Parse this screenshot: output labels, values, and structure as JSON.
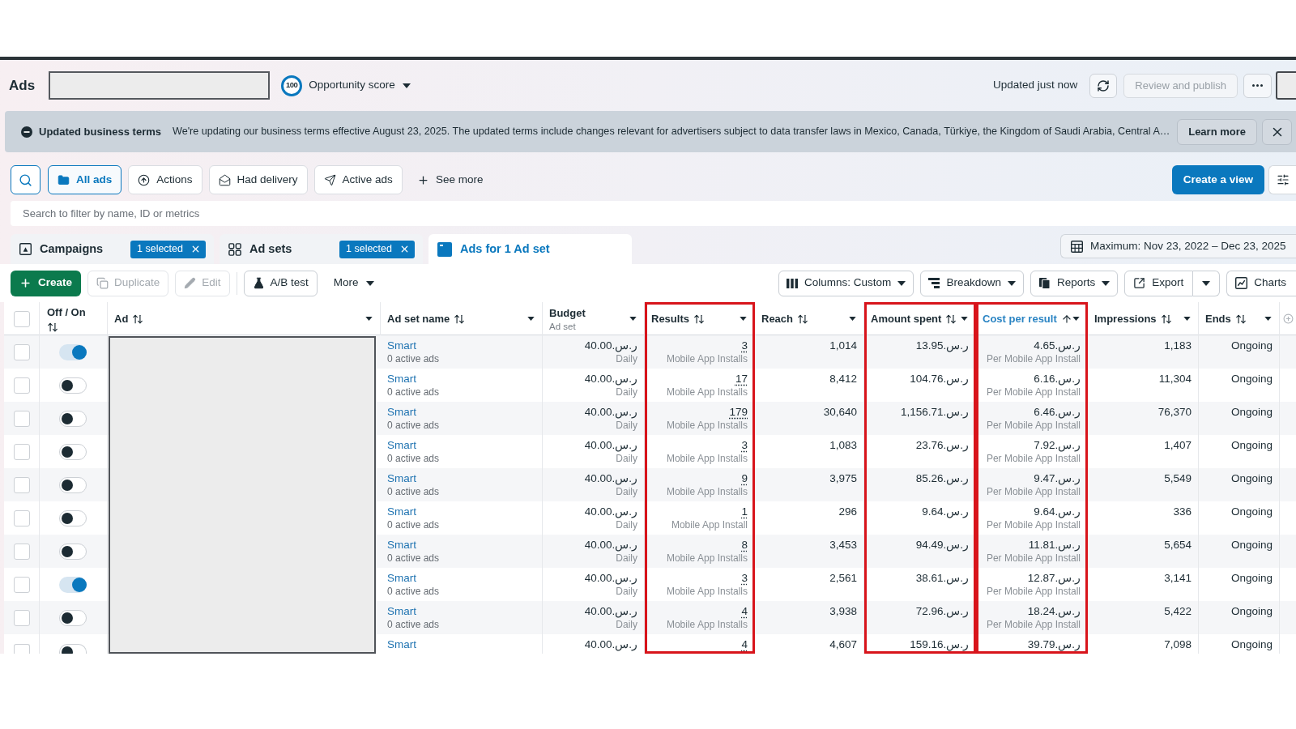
{
  "header": {
    "title": "Ads",
    "opportunity_score": {
      "value": "100",
      "label": "Opportunity score"
    },
    "update_status": "Updated just now",
    "review_button": {
      "label": "Review and publish",
      "disabled": true
    }
  },
  "notice": {
    "title": "Updated business terms",
    "message": "We're updating our business terms effective August 23, 2025. The updated terms include changes relevant for advertisers subject to data transfer laws in Mexico, Canada, Türkiye, the Kingdom of Saudi Arabia, Central A…",
    "action": "Learn more"
  },
  "views": {
    "items": [
      {
        "label": "All ads",
        "selected": true
      },
      {
        "label": "Actions",
        "selected": false
      },
      {
        "label": "Had delivery",
        "selected": false
      },
      {
        "label": "Active ads",
        "selected": false
      }
    ],
    "see_more": "See more",
    "create_view": "Create a view"
  },
  "search": {
    "placeholder": "Search to filter by name, ID or metrics"
  },
  "levels": {
    "tabs": [
      {
        "label": "Campaigns",
        "badge": "1 selected",
        "selected": false
      },
      {
        "label": "Ad sets",
        "badge": "1 selected",
        "selected": false
      },
      {
        "label": "Ads for 1 Ad set",
        "selected": true
      }
    ],
    "date_range": "Maximum: Nov 23, 2022 – Dec 23, 2025"
  },
  "toolbar": {
    "left": [
      {
        "label": "Create",
        "kind": "primary",
        "disabled": false
      },
      {
        "label": "Duplicate",
        "kind": "outline",
        "disabled": true
      },
      {
        "label": "Edit",
        "kind": "outline",
        "disabled": true
      },
      {
        "label": "A/B test",
        "kind": "outline",
        "disabled": false
      },
      {
        "label": "More",
        "kind": "menu",
        "disabled": false
      }
    ],
    "right": [
      {
        "label": "Columns: Custom",
        "kind": "menu"
      },
      {
        "label": "Breakdown",
        "kind": "menu"
      },
      {
        "label": "Reports",
        "kind": "menu"
      },
      {
        "label": "Export",
        "kind": "split"
      },
      {
        "label": "Charts",
        "kind": "plain"
      }
    ]
  },
  "table": {
    "select_all_checked": false,
    "columns": [
      {
        "label": "Off / On",
        "sortable": true,
        "sorted": false,
        "highlighted": false
      },
      {
        "label": "Ad",
        "sortable": true,
        "sorted": false,
        "highlighted": false
      },
      {
        "label": "Ad set name",
        "sortable": true,
        "sorted": false,
        "highlighted": false
      },
      {
        "label": "Budget",
        "sublabel": "Ad set",
        "sortable": false,
        "sorted": false,
        "highlighted": false
      },
      {
        "label": "Results",
        "sortable": true,
        "sorted": false,
        "highlighted": true
      },
      {
        "label": "Reach",
        "sortable": true,
        "sorted": false,
        "highlighted": false
      },
      {
        "label": "Amount spent",
        "sortable": true,
        "sorted": false,
        "highlighted": true
      },
      {
        "label": "Cost per result",
        "sortable": true,
        "sorted": true,
        "highlighted": true
      },
      {
        "label": "Impressions",
        "sortable": true,
        "sorted": false,
        "highlighted": false
      },
      {
        "label": "Ends",
        "sortable": true,
        "sorted": false,
        "highlighted": false
      }
    ],
    "rows": [
      {
        "selected": false,
        "on": true,
        "ad_set_name": "Smart",
        "ad_set_status": "0 active ads",
        "budget": "ر.س.40.00",
        "budget_period": "Daily",
        "results": "3",
        "result_type": "Mobile App Installs",
        "reach": "1,014",
        "amount_spent": "ر.س.13.95",
        "cost_per_result": "ر.س.4.65",
        "cost_basis": "Per Mobile App Install",
        "impressions": "1,183",
        "ends": "Ongoing"
      },
      {
        "selected": false,
        "on": false,
        "ad_set_name": "Smart",
        "ad_set_status": "0 active ads",
        "budget": "ر.س.40.00",
        "budget_period": "Daily",
        "results": "17",
        "result_type": "Mobile App Installs",
        "reach": "8,412",
        "amount_spent": "ر.س.104.76",
        "cost_per_result": "ر.س.6.16",
        "cost_basis": "Per Mobile App Install",
        "impressions": "11,304",
        "ends": "Ongoing"
      },
      {
        "selected": false,
        "on": false,
        "ad_set_name": "Smart",
        "ad_set_status": "0 active ads",
        "budget": "ر.س.40.00",
        "budget_period": "Daily",
        "results": "179",
        "result_type": "Mobile App Installs",
        "reach": "30,640",
        "amount_spent": "ر.س.1,156.71",
        "cost_per_result": "ر.س.6.46",
        "cost_basis": "Per Mobile App Install",
        "impressions": "76,370",
        "ends": "Ongoing"
      },
      {
        "selected": false,
        "on": false,
        "ad_set_name": "Smart",
        "ad_set_status": "0 active ads",
        "budget": "ر.س.40.00",
        "budget_period": "Daily",
        "results": "3",
        "result_type": "Mobile App Installs",
        "reach": "1,083",
        "amount_spent": "ر.س.23.76",
        "cost_per_result": "ر.س.7.92",
        "cost_basis": "Per Mobile App Install",
        "impressions": "1,407",
        "ends": "Ongoing"
      },
      {
        "selected": false,
        "on": false,
        "ad_set_name": "Smart",
        "ad_set_status": "0 active ads",
        "budget": "ر.س.40.00",
        "budget_period": "Daily",
        "results": "9",
        "result_type": "Mobile App Installs",
        "reach": "3,975",
        "amount_spent": "ر.س.85.26",
        "cost_per_result": "ر.س.9.47",
        "cost_basis": "Per Mobile App Install",
        "impressions": "5,549",
        "ends": "Ongoing"
      },
      {
        "selected": false,
        "on": false,
        "ad_set_name": "Smart",
        "ad_set_status": "0 active ads",
        "budget": "ر.س.40.00",
        "budget_period": "Daily",
        "results": "1",
        "result_type": "Mobile App Install",
        "reach": "296",
        "amount_spent": "ر.س.9.64",
        "cost_per_result": "ر.س.9.64",
        "cost_basis": "Per Mobile App Install",
        "impressions": "336",
        "ends": "Ongoing"
      },
      {
        "selected": false,
        "on": false,
        "ad_set_name": "Smart",
        "ad_set_status": "0 active ads",
        "budget": "ر.س.40.00",
        "budget_period": "Daily",
        "results": "8",
        "result_type": "Mobile App Installs",
        "reach": "3,453",
        "amount_spent": "ر.س.94.49",
        "cost_per_result": "ر.س.11.81",
        "cost_basis": "Per Mobile App Install",
        "impressions": "5,654",
        "ends": "Ongoing"
      },
      {
        "selected": false,
        "on": true,
        "ad_set_name": "Smart",
        "ad_set_status": "0 active ads",
        "budget": "ر.س.40.00",
        "budget_period": "Daily",
        "results": "3",
        "result_type": "Mobile App Installs",
        "reach": "2,561",
        "amount_spent": "ر.س.38.61",
        "cost_per_result": "ر.س.12.87",
        "cost_basis": "Per Mobile App Install",
        "impressions": "3,141",
        "ends": "Ongoing"
      },
      {
        "selected": false,
        "on": false,
        "ad_set_name": "Smart",
        "ad_set_status": "0 active ads",
        "budget": "ر.س.40.00",
        "budget_period": "Daily",
        "results": "4",
        "result_type": "Mobile App Installs",
        "reach": "3,938",
        "amount_spent": "ر.س.72.96",
        "cost_per_result": "ر.س.18.24",
        "cost_basis": "Per Mobile App Install",
        "impressions": "5,422",
        "ends": "Ongoing"
      },
      {
        "selected": false,
        "on": false,
        "ad_set_name": "Smart",
        "budget": "ر.س.40.00",
        "results": "4",
        "reach": "4,607",
        "amount_spent": "ر.س.159.16",
        "cost_per_result": "ر.س.39.79",
        "impressions": "7,098",
        "ends": "Ongoing"
      }
    ]
  }
}
